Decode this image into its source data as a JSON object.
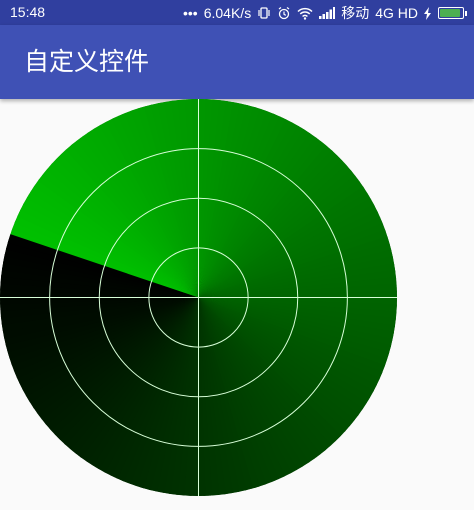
{
  "status_bar": {
    "time": "15:48",
    "dots": "•••",
    "network_speed": "6.04K/s",
    "carrier": "移动",
    "network_type": "4G HD",
    "battery_level": 0.9
  },
  "app_bar": {
    "title": "自定义控件"
  },
  "radar": {
    "ring_count": 4,
    "sweep_angle_deg": 198,
    "colors": {
      "base": "#003300",
      "sweep": "#00c000",
      "grid": "#d8ffd8"
    }
  }
}
